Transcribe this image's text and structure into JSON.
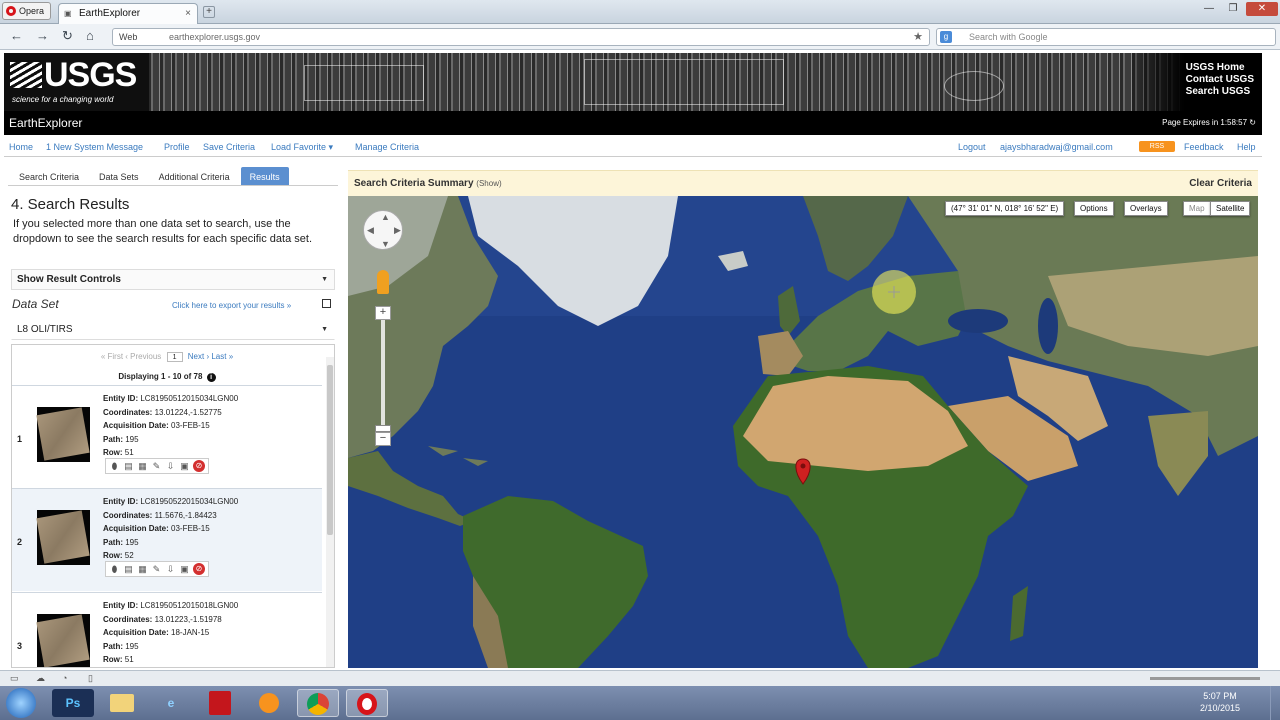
{
  "browser": {
    "opera_label": "Opera",
    "tab_title": "EarthExplorer",
    "address_prefix": "Web",
    "url": "earthexplorer.usgs.gov",
    "search_placeholder": "Search with Google"
  },
  "banner": {
    "logo_text": "USGS",
    "tagline": "science for a changing world",
    "links": [
      "USGS Home",
      "Contact USGS",
      "Search USGS"
    ],
    "app_title": "EarthExplorer",
    "page_expires": "Page Expires in 1:58:57"
  },
  "menu": {
    "left": [
      "Home",
      "1 New System Message",
      "Profile",
      "Save Criteria",
      "Load Favorite ▾",
      "Manage Criteria"
    ],
    "right": [
      "Logout",
      "ajaysbharadwaj@gmail.com",
      "RSS",
      "Feedback",
      "Help"
    ]
  },
  "left_panel": {
    "tabs": [
      "Search Criteria",
      "Data Sets",
      "Additional Criteria",
      "Results"
    ],
    "active_tab": "Results",
    "title": "4. Search Results",
    "description": "If you selected more than one data set to search, use the dropdown to see the search results for each specific data set.",
    "result_controls": "Show Result Controls",
    "data_set_label": "Data Set",
    "export_link": "Click here to export your results »",
    "data_set_value": "L8 OLI/TIRS",
    "pager": {
      "first": "« First",
      "previous": "‹ Previous",
      "page": "1",
      "next": "Next ›",
      "last": "Last »"
    },
    "displaying": "Displaying 1 - 10 of 78",
    "results": [
      {
        "num": "1",
        "entity_label": "Entity ID:",
        "entity": "LC81950512015034LGN00",
        "coords_label": "Coordinates:",
        "coords": "13.01224,-1.52775",
        "date_label": "Acquisition Date:",
        "date": "03-FEB-15",
        "path_label": "Path:",
        "path": "195",
        "row_label": "Row:",
        "row": "51"
      },
      {
        "num": "2",
        "entity_label": "Entity ID:",
        "entity": "LC81950522015034LGN00",
        "coords_label": "Coordinates:",
        "coords": "11.5676,-1.84423",
        "date_label": "Acquisition Date:",
        "date": "03-FEB-15",
        "path_label": "Path:",
        "path": "195",
        "row_label": "Row:",
        "row": "52"
      },
      {
        "num": "3",
        "entity_label": "Entity ID:",
        "entity": "LC81950512015018LGN00",
        "coords_label": "Coordinates:",
        "coords": "13.01223,-1.51978",
        "date_label": "Acquisition Date:",
        "date": "18-JAN-15",
        "path_label": "Path:",
        "path": "195",
        "row_label": "Row:",
        "row": "51"
      }
    ]
  },
  "map": {
    "criteria_summary": "Search Criteria Summary",
    "show_link": "(Show)",
    "clear_criteria": "Clear Criteria",
    "coordinates_readout": "(47° 31' 01\" N, 018° 16' 52\" E)",
    "options": "Options",
    "overlays": "Overlays",
    "map_type": "Map",
    "satellite": "Satellite"
  },
  "taskbar": {
    "time": "5:07 PM",
    "date": "2/10/2015",
    "apps": [
      "Ps",
      "Explorer",
      "IE",
      "Acrobat",
      "Media",
      "Chrome",
      "Opera"
    ]
  },
  "colors": {
    "link": "#3b7bbf",
    "active_tab": "#5b8fd0",
    "criteria_bar": "#fdf5d9",
    "ocean": "#1d3a7a"
  }
}
